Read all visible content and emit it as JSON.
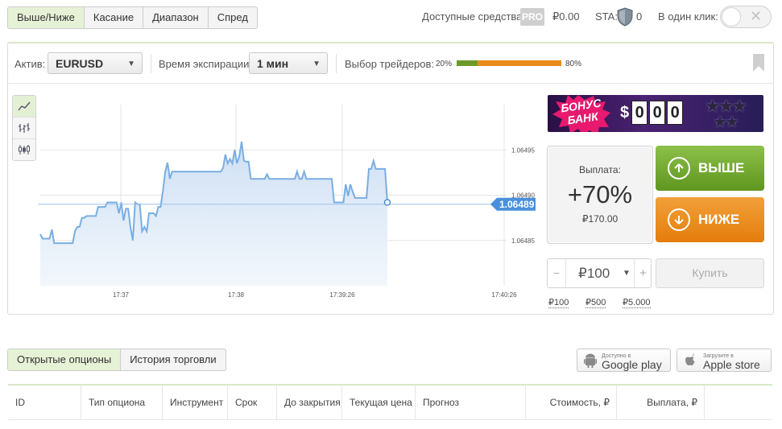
{
  "top_tabs": [
    "Выше/Ниже",
    "Касание",
    "Диапазон",
    "Спред"
  ],
  "header": {
    "funds_label": "Доступные средства:",
    "pro_badge": "PRO",
    "funds_value": "₽0.00",
    "sta_label": "STA:",
    "sta_value": "0",
    "one_click_label": "В один клик:"
  },
  "controls": {
    "asset_label": "Актив:",
    "asset_value": "EURUSD",
    "expiry_label": "Время экспирации:",
    "expiry_value": "1 мин",
    "traders_label": "Выбор трейдеров:",
    "traders_left_pct": "20%",
    "traders_right_pct": "80%",
    "traders_left_fraction": 0.2
  },
  "chart_data": {
    "type": "area",
    "x_ticks": [
      "17:37",
      "17:38",
      "17:39:26",
      "17:40:26"
    ],
    "y_ticks": [
      "1.06495",
      "1.06490",
      "1.06485"
    ],
    "current_price": "1.06489",
    "ylim": [
      1.0648,
      1.065
    ],
    "series": [
      {
        "values": [
          1.064857,
          1.064852,
          1.064852,
          1.064852,
          1.064852,
          1.064862,
          1.064847,
          1.064847,
          1.064847,
          1.064847,
          1.064847,
          1.064847,
          1.064847,
          1.064847,
          1.064847,
          1.06486,
          1.064865,
          1.064865,
          1.064875,
          1.064875,
          1.064877,
          1.064877,
          1.064877,
          1.064877,
          1.064877,
          1.064887,
          1.064887,
          1.064887,
          1.064887,
          1.064892,
          1.064892,
          1.064892,
          1.064892,
          1.064892,
          1.06488,
          1.064892,
          1.064872,
          1.064885,
          1.064885,
          1.064864,
          1.06485,
          1.064892,
          1.06489,
          1.06489,
          1.06486,
          1.064865,
          1.06486,
          1.06488,
          1.06488,
          1.06488,
          1.064877,
          1.064887,
          1.064887,
          1.064905,
          1.064926,
          1.064936,
          1.064918,
          1.064926,
          1.064926,
          1.064926,
          1.064926,
          1.064926,
          1.064926,
          1.064926,
          1.064926,
          1.064926,
          1.064926,
          1.064926,
          1.064926,
          1.064926,
          1.064926,
          1.064926,
          1.064926,
          1.064926,
          1.064926,
          1.064926,
          1.064926,
          1.064926,
          1.064926,
          1.06493,
          1.064945,
          1.064935,
          1.06494,
          1.064935,
          1.06495,
          1.064935,
          1.064943,
          1.064959,
          1.064938,
          1.064937,
          1.064937,
          1.064918,
          1.064918,
          1.064918,
          1.064918,
          1.064918,
          1.064918,
          1.064918,
          1.064923,
          1.064918,
          1.064918,
          1.064918,
          1.064918,
          1.064918,
          1.064918,
          1.064918,
          1.064918,
          1.064918,
          1.064918,
          1.064918,
          1.064918,
          1.064926,
          1.064918,
          1.064918,
          1.064926,
          1.064918,
          1.064918,
          1.064918,
          1.064918,
          1.064918,
          1.064918,
          1.064918,
          1.064918,
          1.064918,
          1.064918,
          1.064918,
          1.064918,
          1.064892,
          1.064892,
          1.064892,
          1.064892,
          1.064892,
          1.064912,
          1.064899,
          1.064912,
          1.064904,
          1.064897,
          1.064897,
          1.064897,
          1.064897,
          1.064897,
          1.064897,
          1.064929,
          1.064929,
          1.064938,
          1.064929,
          1.064929,
          1.064929,
          1.064929,
          1.064929,
          1.064892
        ]
      }
    ]
  },
  "bonus": {
    "title_line1": "БОНУС",
    "title_line2": "БАНК",
    "currency": "$",
    "digits": [
      "0",
      "0",
      "0"
    ]
  },
  "payout": {
    "label": "Выплата:",
    "percent": "+70%",
    "amount": "₽170.00"
  },
  "buttons": {
    "up": "ВЫШЕ",
    "down": "НИЖЕ",
    "buy": "Купить"
  },
  "amount": {
    "minus": "−",
    "value": "₽100",
    "plus": "+",
    "presets": [
      "₽100",
      "₽500",
      "₽5.000"
    ]
  },
  "bottom_tabs": [
    "Открытые опционы",
    "История торговли"
  ],
  "stores": {
    "google_small": "Доступно в",
    "google_big": "Google play",
    "apple_small": "Загрузите в",
    "apple_big": "Apple store"
  },
  "table_columns": [
    "ID",
    "Тип опциона",
    "Инструмент",
    "Срок",
    "До закрытия",
    "Текущая цена",
    "Прогноз",
    "Стоимость, ₽",
    "Выплата, ₽"
  ]
}
